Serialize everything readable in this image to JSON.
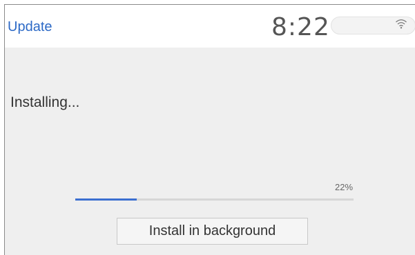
{
  "header": {
    "title": "Update",
    "time": "8:22"
  },
  "status": {
    "icons": [
      "wifi-icon"
    ]
  },
  "install": {
    "status_text": "Installing...",
    "progress_percent": 22,
    "progress_label": "22%",
    "button_label": "Install in background"
  },
  "colors": {
    "accent": "#2c69c6",
    "progress": "#3b6fd0",
    "background": "#efefef"
  }
}
